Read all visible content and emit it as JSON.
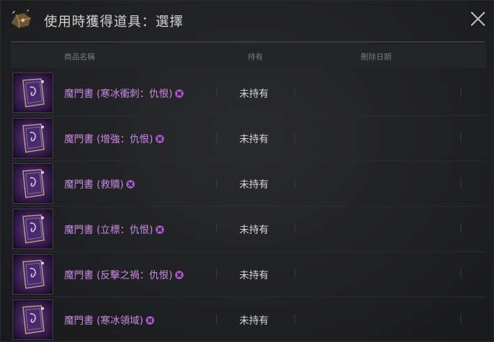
{
  "window": {
    "title": "使用時獲得道具：選擇",
    "title_icon": "treasure-chest-icon",
    "close_icon": "close-icon"
  },
  "table": {
    "headers": {
      "name": "商品名稱",
      "have": "持有",
      "delete_date": "刪除日期"
    },
    "rows": [
      {
        "name": "魔門書 (寒冰衝刺：仇恨)",
        "have": "未持有",
        "delete_date": "",
        "icon": "grimoire-book-icon"
      },
      {
        "name": "魔門書 (增強：仇恨)",
        "have": "未持有",
        "delete_date": "",
        "icon": "grimoire-book-icon"
      },
      {
        "name": "魔門書 (救贖)",
        "have": "未持有",
        "delete_date": "",
        "icon": "grimoire-book-icon"
      },
      {
        "name": "魔門書 (立標：仇恨)",
        "have": "未持有",
        "delete_date": "",
        "icon": "grimoire-book-icon"
      },
      {
        "name": "魔門書 (反擊之禍：仇恨)",
        "have": "未持有",
        "delete_date": "",
        "icon": "grimoire-book-icon"
      },
      {
        "name": "魔門書 (寒冰領域)",
        "have": "未持有",
        "delete_date": "",
        "icon": "grimoire-book-icon"
      }
    ]
  },
  "colors": {
    "item_name": "#c98ae6",
    "badge": "#a45ac6",
    "background": "#1e1f21"
  }
}
